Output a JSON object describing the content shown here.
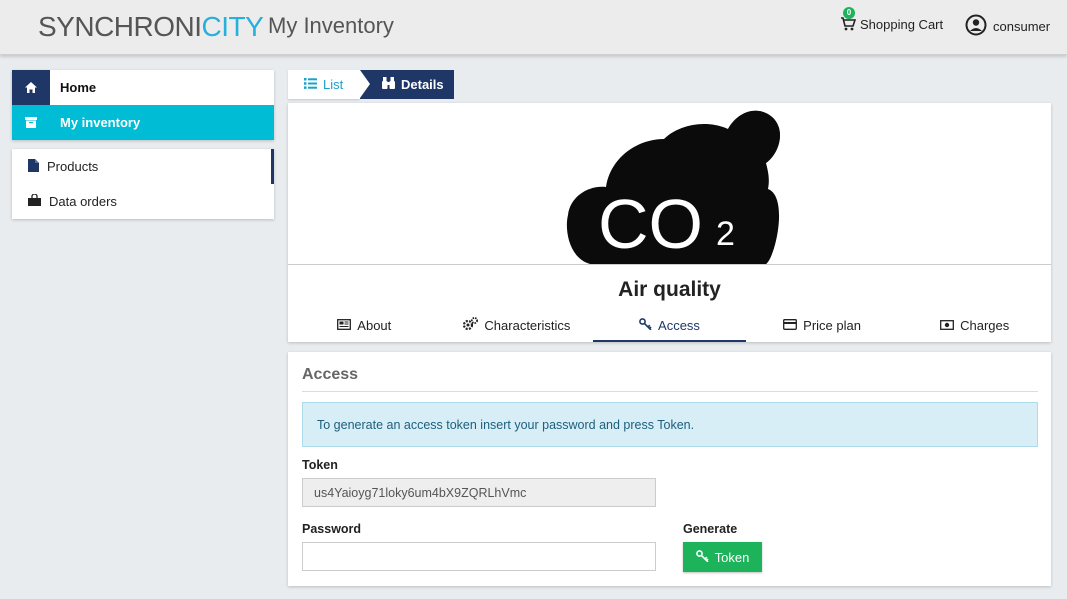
{
  "header": {
    "brand_part1": "SYNCHRONI",
    "brand_part2": "CITY",
    "app_title": "My Inventory",
    "cart_label": "Shopping Cart",
    "cart_count": "0",
    "user_name": "consumer"
  },
  "sidebar": {
    "nav": [
      {
        "label": "Home",
        "icon": "home-icon"
      },
      {
        "label": "My inventory",
        "icon": "archive-icon"
      }
    ],
    "items": [
      {
        "label": "Products",
        "icon": "file-icon"
      },
      {
        "label": "Data orders",
        "icon": "shopping-bag-icon"
      }
    ]
  },
  "breadcrumb": {
    "list_label": "List",
    "details_label": "Details"
  },
  "product": {
    "title": "Air quality",
    "image_text": "CO",
    "image_subscript": "2",
    "tabs": [
      {
        "label": "About",
        "icon": "newspaper-icon"
      },
      {
        "label": "Characteristics",
        "icon": "cogs-icon"
      },
      {
        "label": "Access",
        "icon": "key-icon"
      },
      {
        "label": "Price plan",
        "icon": "credit-card-icon"
      },
      {
        "label": "Charges",
        "icon": "money-icon"
      }
    ]
  },
  "access": {
    "title": "Access",
    "info_text": "To generate an access token insert your password and press Token.",
    "token_label": "Token",
    "token_value": "us4Yaioyg71loky6um4bX9ZQRLhVmc",
    "password_label": "Password",
    "password_value": "",
    "generate_label": "Generate",
    "token_button": "Token"
  },
  "colors": {
    "primary": "#1f3766",
    "accent": "#00bcd4",
    "success": "#1cb35b",
    "info_bg": "#d7eef7"
  }
}
